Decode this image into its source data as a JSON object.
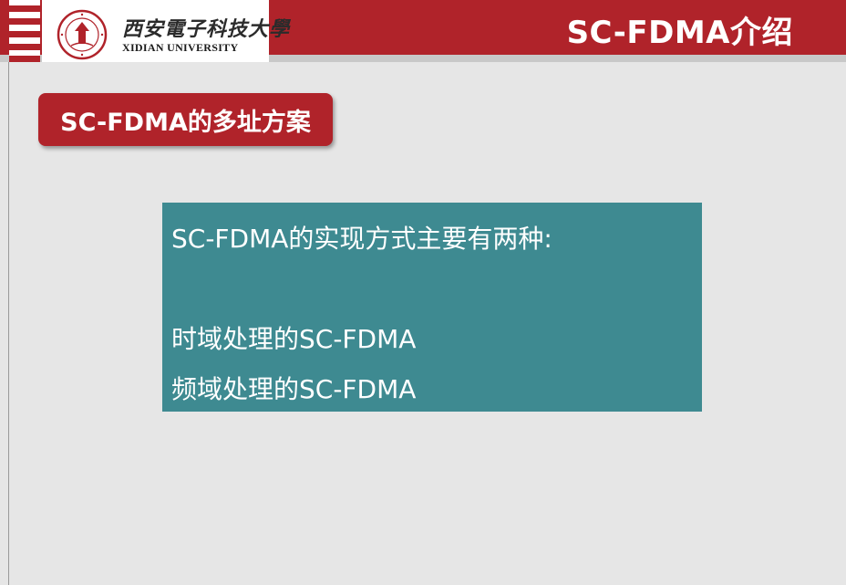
{
  "header": {
    "title": "SC-FDMA介绍",
    "logo": {
      "name_cn": "西安電子科技大學",
      "name_en": "XIDIAN UNIVERSITY"
    }
  },
  "section": {
    "tag": "SC-FDMA的多址方案"
  },
  "content": {
    "lines": [
      "SC-FDMA的实现方式主要有两种:",
      "时域处理的SC-FDMA",
      "频域处理的SC-FDMA"
    ]
  },
  "colors": {
    "brand_red": "#b0232a",
    "content_teal": "#3e8a91",
    "background": "#e6e6e6"
  }
}
